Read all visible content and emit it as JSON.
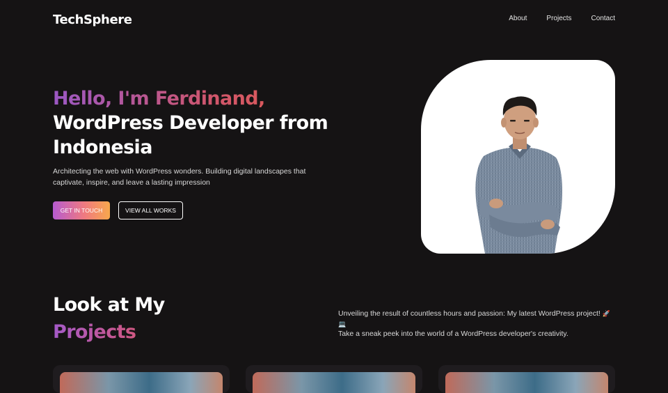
{
  "nav": {
    "logo": "TechSphere",
    "links": [
      "About",
      "Projects",
      "Contact"
    ]
  },
  "hero": {
    "greeting": "Hello, I'm Ferdinand,",
    "title_line2": "WordPress Developer from",
    "title_line3": "Indonesia",
    "description": "Architecting the web with WordPress wonders. Building digital landscapes that captivate, inspire, and leave a lasting impression",
    "primary_button": "GET IN TOUCH",
    "secondary_button": "VIEW ALL WORKS"
  },
  "projects_section": {
    "title_line1": "Look at My",
    "title_line2": "Projects",
    "description": "Unveiling the result of countless hours and passion: My latest WordPress project!",
    "description_emoji": "🚀 💻",
    "description_line2": "Take a sneak peek into the world of a WordPress developer's creativity."
  },
  "colors": {
    "background": "#151314",
    "accent_purple": "#9b58c4",
    "accent_orange": "#f8a84c",
    "card_bg": "#1f1c1f"
  }
}
